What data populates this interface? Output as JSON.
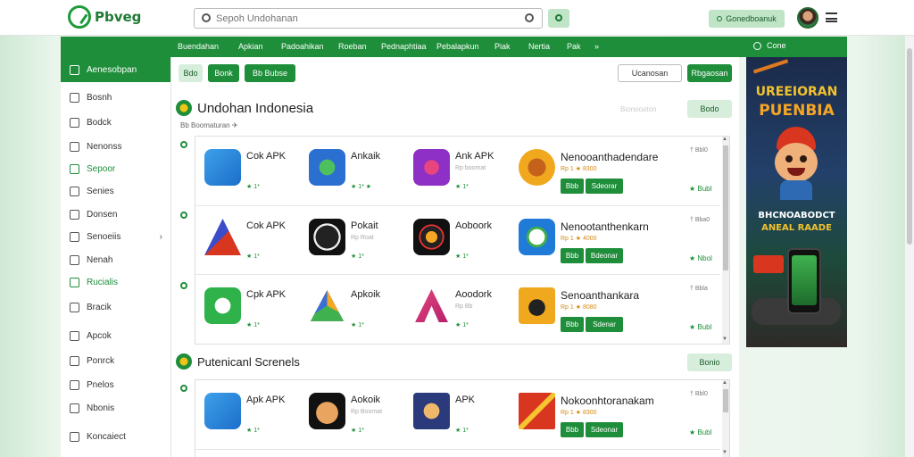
{
  "header": {
    "logo_text": "Pbveg",
    "logo_accent": "#1e8e3a",
    "search_placeholder": "Sepoh Undohanan",
    "top_action": "Gonedboanuk"
  },
  "nav": {
    "items": [
      "Buendahan",
      "Apkian",
      "Padoahikan",
      "Roeban",
      "Pednaphtiaa",
      "Pebalapkun",
      "Piak",
      "Nertia",
      "Pak",
      "»"
    ],
    "search_label": "Cone"
  },
  "sidebar": {
    "header": "Aenesobpan",
    "items": [
      {
        "label": "Bosnh",
        "icon": "home-icon"
      },
      {
        "label": "Bodck",
        "icon": "book-icon"
      },
      {
        "label": "Nenonss",
        "icon": "grid-icon"
      },
      {
        "label": "Sepoor",
        "icon": "support-icon",
        "active": true
      },
      {
        "label": "Senies",
        "icon": "series-icon"
      },
      {
        "label": "Donsen",
        "icon": "dock-icon"
      },
      {
        "label": "Senoeiis",
        "icon": "settings-icon",
        "chevron": "›"
      },
      {
        "label": "Nenah",
        "icon": "news-icon"
      },
      {
        "label": "Rucialis",
        "icon": "tag-icon",
        "active": true
      },
      {
        "label": "Bracik",
        "icon": "folder-icon"
      },
      {
        "label": "Apcok",
        "icon": "pin-icon"
      },
      {
        "label": "Ponrck",
        "icon": "user-icon"
      },
      {
        "label": "Pnelos",
        "icon": "photo-icon"
      },
      {
        "label": "Nbonis",
        "icon": "music-icon"
      },
      {
        "label": "Koncaiect",
        "icon": "contact-icon"
      }
    ]
  },
  "filters": {
    "f1": "Bdo",
    "f2": "Bonk",
    "f3": "Bb Bubse",
    "sort": "Ucanosan",
    "action": "Rbgaosan"
  },
  "section1": {
    "title": "Undohan Indonesia",
    "subtitle": "Bb  Boomaturan",
    "subtitle_icon": "✈",
    "button": "Bodo",
    "ghost": "Bionooaton"
  },
  "section2": {
    "title": "Putenicanl Screnels",
    "button": "Bonio"
  },
  "rows": [
    {
      "apps": [
        {
          "name": "Cok APK",
          "meta": "",
          "rating": "★ 1*",
          "color": "#2a8ad8",
          "icon": "apk-arrow-icon"
        },
        {
          "name": "Ankaik",
          "meta": "",
          "rating": "★ 1* ★",
          "color": "#2b6fd1",
          "icon": "android-icon"
        },
        {
          "name": "Ank APK",
          "meta": "Rp boomat",
          "rating": "★ 1*",
          "color": "#8e2fc5",
          "icon": "music-app-icon"
        }
      ],
      "wide": {
        "name": "Nenooanthadendare",
        "meta": "Rp 1 ★ 8300",
        "btn1": "Bbb",
        "btn2": "Sdeorar",
        "color": "#f0a81e",
        "icon": "game-face-icon"
      },
      "side": "† Bbl0",
      "rating": "★ Bubl"
    },
    {
      "apps": [
        {
          "name": "Cok APK",
          "meta": "",
          "rating": "★ 1*",
          "color": "#2b3aa8",
          "icon": "apk-a-icon"
        },
        {
          "name": "Pokait",
          "meta": "Rp Roat",
          "rating": "★ 1*",
          "color": "#222222",
          "icon": "circle-app-icon"
        },
        {
          "name": "Aoboork",
          "meta": "",
          "rating": "★ 1*",
          "color": "#222222",
          "icon": "vr-app-icon"
        }
      ],
      "wide": {
        "name": "Nenootanthenkarn",
        "meta": "Rp 1 ★ 4000",
        "btn1": "Bbb",
        "btn2": "Bdeonar",
        "color": "#1f7ad8",
        "icon": "football-icon"
      },
      "side": "† Bba0",
      "rating": "★ Nbol"
    },
    {
      "apps": [
        {
          "name": "Cpk APK",
          "meta": "",
          "rating": "★ 1*",
          "color": "#1f9a3a",
          "icon": "whatsapp-icon"
        },
        {
          "name": "Apkoik",
          "meta": "",
          "rating": "★ 1*",
          "color": "#222222",
          "icon": "triangle-app-icon"
        },
        {
          "name": "Aoodork",
          "meta": "Rp Bb",
          "rating": "★ 1*",
          "color": "#ffffff",
          "icon": "a-logo-icon"
        }
      ],
      "wide": {
        "name": "Senoanthankara",
        "meta": "Rp 1 ★ 8080",
        "btn1": "Bbb",
        "btn2": "Sdenar",
        "color": "#f0a81e",
        "icon": "face-app-icon"
      },
      "side": "† Bbla",
      "rating": "★ Bubl"
    },
    {
      "apps": [
        {
          "name": "Apk APK",
          "meta": "",
          "rating": "★ 1*",
          "color": "#2a8ad8",
          "icon": "apk-arrow-icon"
        },
        {
          "name": "Aokoik",
          "meta": "Rp Boomat",
          "rating": "★ 1*",
          "color": "#222222",
          "icon": "face-app-icon"
        },
        {
          "name": "APK",
          "meta": "",
          "rating": "★ 1*",
          "color": "#2a3a7a",
          "icon": "elephant-app-icon"
        }
      ],
      "wide": {
        "name": "Nokoonhtoranakam",
        "meta": "Rp 1 ★ 8300",
        "btn1": "Bbb",
        "btn2": "Sdeonar",
        "color": "#d8361f",
        "icon": "frame-app-icon"
      },
      "side": "† Bbl0",
      "rating": "★ Bubl"
    }
  ],
  "banner": {
    "line1": "UREEIORAN",
    "line2": "PUENBIA",
    "line3": "BHCNOABODCT",
    "line4": "ANEAL RAADE"
  }
}
